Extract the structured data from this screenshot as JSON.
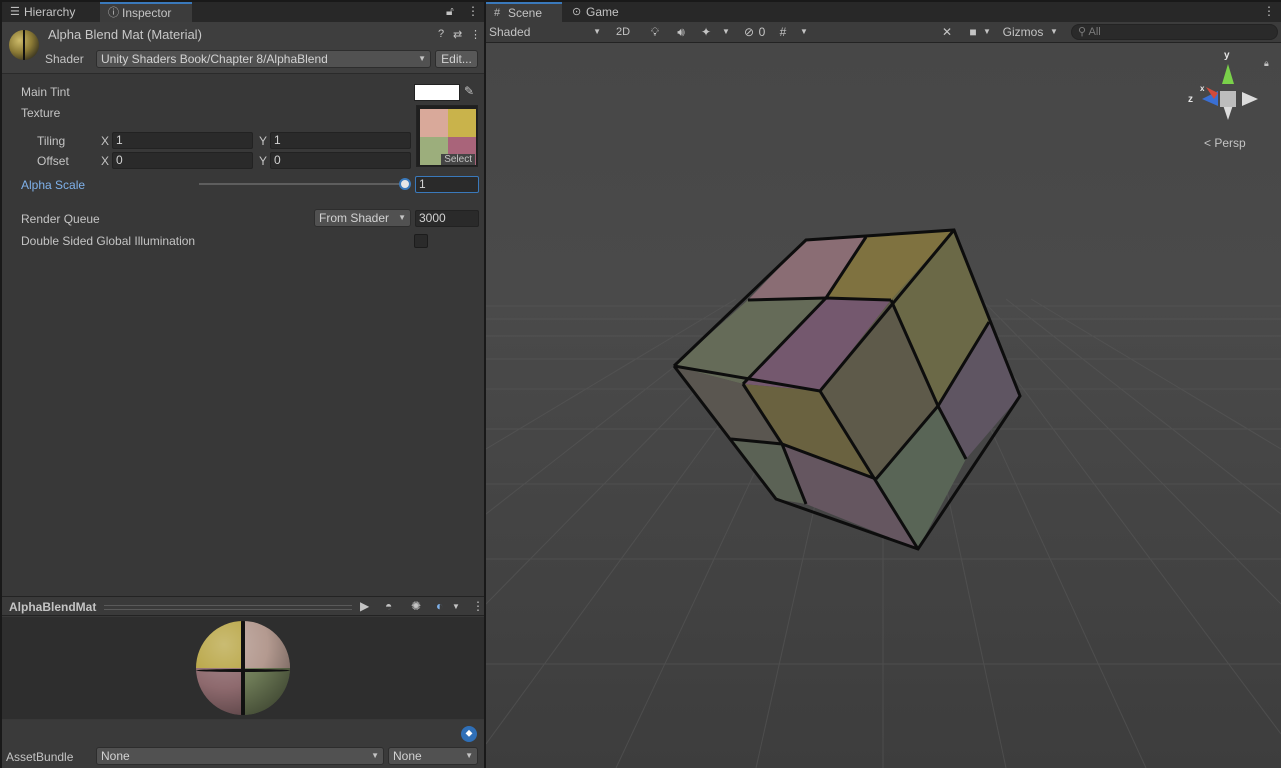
{
  "left_tabs": {
    "hierarchy": "Hierarchy",
    "inspector": "Inspector"
  },
  "inspector": {
    "title": "Alpha Blend Mat (Material)",
    "shader_label": "Shader",
    "shader_value": "Unity Shaders Book/Chapter 8/AlphaBlend",
    "edit_button": "Edit...",
    "main_tint_label": "Main Tint",
    "main_tint_color": "#ffffff",
    "texture_label": "Texture",
    "tiling_label": "Tiling",
    "tiling_x_label": "X",
    "tiling_x": "1",
    "tiling_y_label": "Y",
    "tiling_y": "1",
    "offset_label": "Offset",
    "offset_x_label": "X",
    "offset_x": "0",
    "offset_y_label": "Y",
    "offset_y": "0",
    "texture_select": "Select",
    "texture_colors": [
      "#d9a99a",
      "#c9b34b",
      "#9cae7c",
      "#a9647a"
    ],
    "alpha_scale_label": "Alpha Scale",
    "alpha_scale_value": "1",
    "alpha_scale_fraction": 1.0,
    "render_queue_label": "Render Queue",
    "render_queue_mode": "From Shader",
    "render_queue_value": "3000",
    "double_sided_label": "Double Sided Global Illumination",
    "double_sided_checked": false
  },
  "preview": {
    "title": "AlphaBlendMat"
  },
  "asset_bundle": {
    "label": "AssetBundle",
    "name_value": "None",
    "variant_value": "None"
  },
  "scene_tabs": {
    "scene": "Scene",
    "game": "Game"
  },
  "scene_toolbar": {
    "draw_mode": "Shaded",
    "mode_2d": "2D",
    "hidden_count": "0",
    "gizmos": "Gizmos",
    "search_placeholder": "All"
  },
  "gizmo": {
    "y_label": "y",
    "z_label": "z",
    "x_label": "x",
    "projection": "Persp"
  },
  "colors": {
    "accent": "#3a79bb",
    "panel_bg": "#383838",
    "scene_bg": "#474747"
  }
}
